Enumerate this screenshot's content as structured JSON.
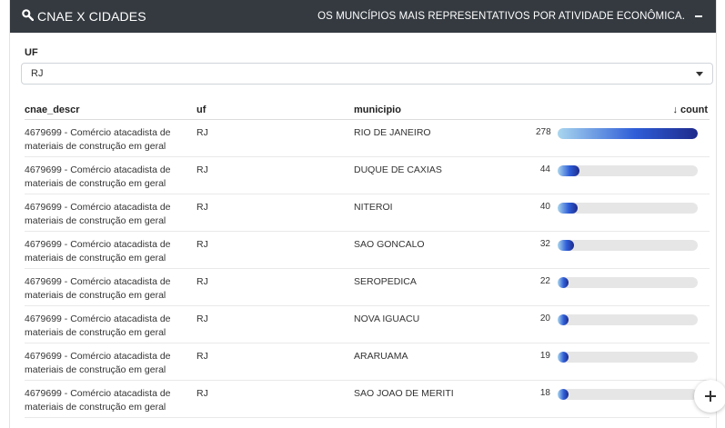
{
  "header": {
    "title": "CNAE X CIDADES",
    "subtitle": "OS MUNCÍPIOS MAIS REPRESENTATIVOS POR ATIVIDADE ECONÔMICA."
  },
  "filter": {
    "label": "UF",
    "selected": "RJ"
  },
  "table": {
    "columns": {
      "cnae_descr": "cnae_descr",
      "uf": "uf",
      "municipio": "municipio",
      "count": "↓ count"
    },
    "max_count": 278,
    "rows": [
      {
        "cnae_descr": "4679699 - Comércio atacadista de materiais de construção em geral",
        "uf": "RJ",
        "municipio": "RIO DE JANEIRO",
        "count": 278
      },
      {
        "cnae_descr": "4679699 - Comércio atacadista de materiais de construção em geral",
        "uf": "RJ",
        "municipio": "DUQUE DE CAXIAS",
        "count": 44
      },
      {
        "cnae_descr": "4679699 - Comércio atacadista de materiais de construção em geral",
        "uf": "RJ",
        "municipio": "NITEROI",
        "count": 40
      },
      {
        "cnae_descr": "4679699 - Comércio atacadista de materiais de construção em geral",
        "uf": "RJ",
        "municipio": "SAO GONCALO",
        "count": 32
      },
      {
        "cnae_descr": "4679699 - Comércio atacadista de materiais de construção em geral",
        "uf": "RJ",
        "municipio": "SEROPEDICA",
        "count": 22
      },
      {
        "cnae_descr": "4679699 - Comércio atacadista de materiais de construção em geral",
        "uf": "RJ",
        "municipio": "NOVA IGUACU",
        "count": 20
      },
      {
        "cnae_descr": "4679699 - Comércio atacadista de materiais de construção em geral",
        "uf": "RJ",
        "municipio": "ARARUAMA",
        "count": 19
      },
      {
        "cnae_descr": "4679699 - Comércio atacadista de materiais de construção em geral",
        "uf": "RJ",
        "municipio": "SAO JOAO DE MERITI",
        "count": 18
      }
    ]
  },
  "colors": {
    "header_bg": "#343a40",
    "bar_start": "#a9d6ee",
    "bar_end": "#1e2a8c",
    "track": "#e6e6e6"
  },
  "icons": {
    "header": "search-icon",
    "collapse": "minus-icon",
    "select": "caret-down-icon",
    "fab": "plus-icon"
  }
}
